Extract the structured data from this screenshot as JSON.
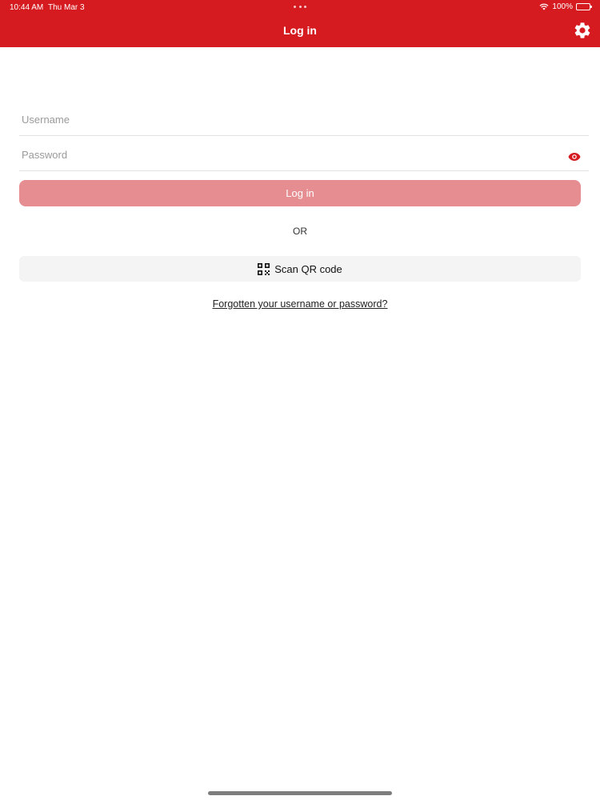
{
  "status_bar": {
    "time": "10:44 AM",
    "date": "Thu Mar 3",
    "battery": "100%"
  },
  "header": {
    "title": "Log in",
    "settings_icon": "gear-icon",
    "background_color": "#d51b20"
  },
  "form": {
    "username_placeholder": "Username",
    "password_placeholder": "Password",
    "password_toggle_icon": "eye-icon",
    "login_button_label": "Log in",
    "login_button_color": "#e68d91"
  },
  "divider_text": "OR",
  "scan": {
    "label": "Scan QR code",
    "icon": "qr-code-icon"
  },
  "forgot_link_text": "Forgotten your username or password?"
}
